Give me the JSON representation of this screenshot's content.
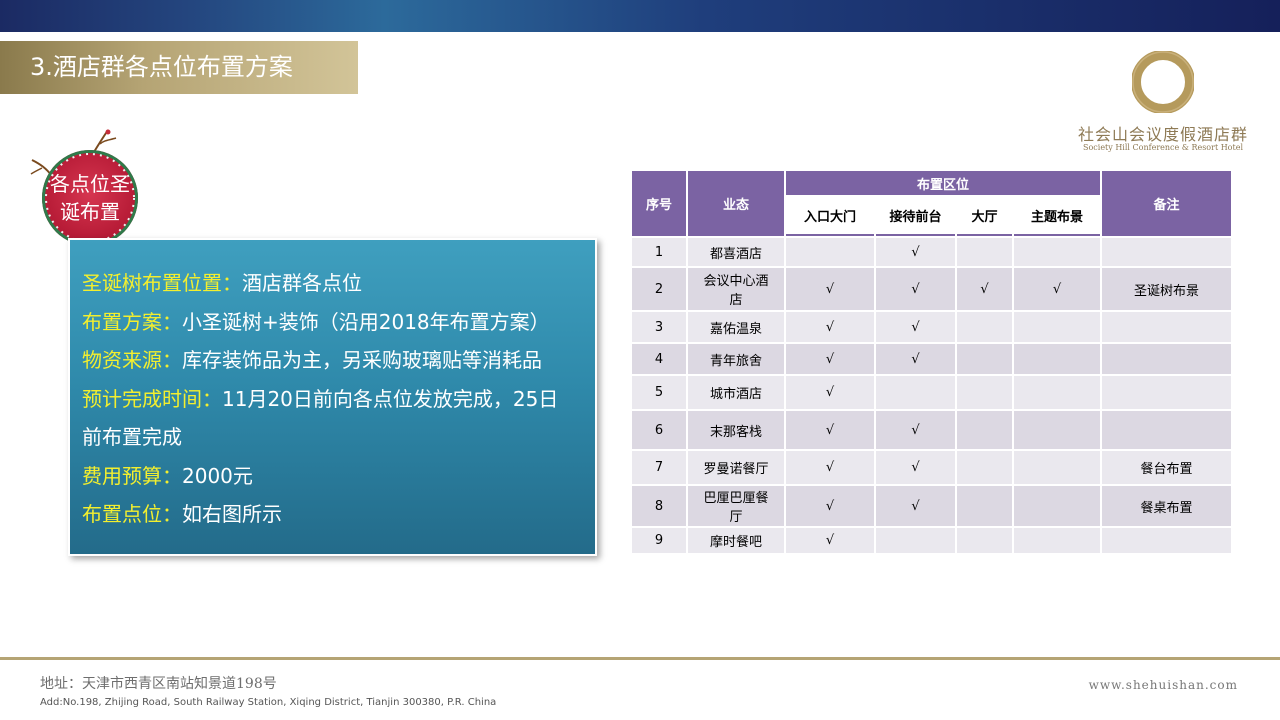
{
  "section_title": "3.酒店群各点位布置方案",
  "brand": {
    "name_cn": "社会山会议度假酒店群",
    "name_en": "Society Hill Conference & Resort Hotel"
  },
  "badge": {
    "line1": "各点位圣",
    "line2": "诞布置"
  },
  "info": [
    {
      "key": "圣诞树布置位置：",
      "value": "酒店群各点位"
    },
    {
      "key": "布置方案：",
      "value": "小圣诞树+装饰（沿用2018年布置方案）"
    },
    {
      "key": "物资来源：",
      "value": "库存装饰品为主，另采购玻璃贴等消耗品"
    },
    {
      "key": "预计完成时间：",
      "value": "11月20日前向各点位发放完成，25日"
    },
    {
      "key": "",
      "value": "前布置完成"
    },
    {
      "key": "费用预算：",
      "value": "2000元"
    },
    {
      "key": "布置点位：",
      "value": "如右图所示"
    }
  ],
  "table": {
    "headers": {
      "seq": "序号",
      "business": "业态",
      "area_group": "布置区位",
      "areas": [
        "入口大门",
        "接待前台",
        "大厅",
        "主题布景"
      ],
      "remark": "备注"
    },
    "rows": [
      {
        "seq": "1",
        "name": "都喜酒店",
        "entrance": "",
        "reception": "√",
        "lobby": "",
        "theme": "",
        "remark": ""
      },
      {
        "seq": "2",
        "name": "会议中心酒店",
        "entrance": "√",
        "reception": "√",
        "lobby": "√",
        "theme": "√",
        "remark": "圣诞树布景"
      },
      {
        "seq": "3",
        "name": "嘉佑温泉",
        "entrance": "√",
        "reception": "√",
        "lobby": "",
        "theme": "",
        "remark": ""
      },
      {
        "seq": "4",
        "name": "青年旅舍",
        "entrance": "√",
        "reception": "√",
        "lobby": "",
        "theme": "",
        "remark": ""
      },
      {
        "seq": "5",
        "name": "城市酒店",
        "entrance": "√",
        "reception": "",
        "lobby": "",
        "theme": "",
        "remark": ""
      },
      {
        "seq": "6",
        "name": "末那客栈",
        "entrance": "√",
        "reception": "√",
        "lobby": "",
        "theme": "",
        "remark": ""
      },
      {
        "seq": "7",
        "name": "罗曼诺餐厅",
        "entrance": "√",
        "reception": "√",
        "lobby": "",
        "theme": "",
        "remark": "餐台布置"
      },
      {
        "seq": "8",
        "name": "巴厘巴厘餐厅",
        "entrance": "√",
        "reception": "√",
        "lobby": "",
        "theme": "",
        "remark": "餐桌布置"
      },
      {
        "seq": "9",
        "name": "摩时餐吧",
        "entrance": "√",
        "reception": "",
        "lobby": "",
        "theme": "",
        "remark": ""
      }
    ]
  },
  "footer": {
    "address_cn": "地址：天津市西青区南站知景道198号",
    "address_en": "Add:No.198, Zhijing Road, South Railway Station, Xiqing District, Tianjin 300380, P.R. China",
    "website": "www.shehuishan.com"
  },
  "colors": {
    "header_band": "#1b2a63",
    "title_gold": "#b5a474",
    "table_header": "#7b63a3",
    "info_key": "#f3ef2e",
    "badge_red": "#b91d38"
  }
}
